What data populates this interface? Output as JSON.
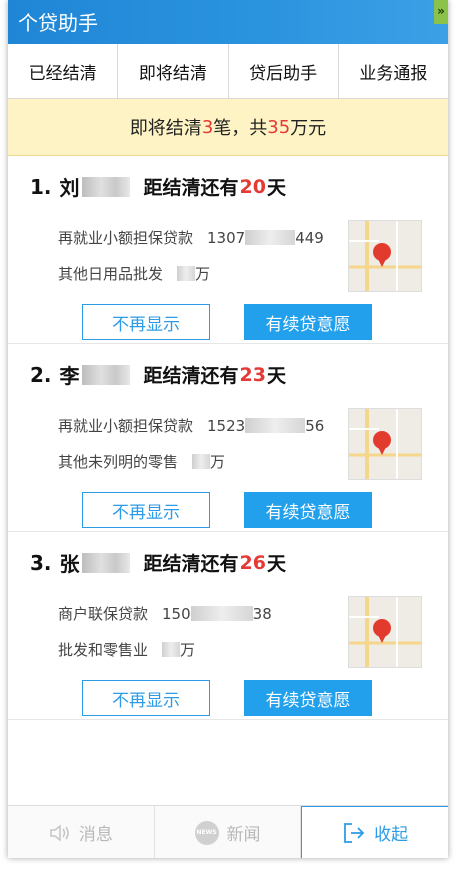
{
  "app": {
    "title": "个贷助手"
  },
  "tabs": [
    {
      "label": "已经结清"
    },
    {
      "label": "即将结清"
    },
    {
      "label": "贷后助手"
    },
    {
      "label": "业务通报"
    }
  ],
  "summary": {
    "prefix": "即将结清",
    "count": "3",
    "mid": "笔，共",
    "amount": "35",
    "suffix": "万元"
  },
  "loans": [
    {
      "index": "1.",
      "surname": "刘",
      "days_prefix": "距结清还有",
      "days": "20",
      "days_suffix": "天",
      "product": "再就业小额担保贷款",
      "phone_start": "1307",
      "phone_end": "449",
      "industry": "其他日用品批发",
      "amount_unit": "万",
      "btn_hide": "不再显示",
      "btn_continue": "有续贷意愿"
    },
    {
      "index": "2.",
      "surname": "李",
      "days_prefix": "距结清还有",
      "days": "23",
      "days_suffix": "天",
      "product": "再就业小额担保贷款",
      "phone_start": "1523",
      "phone_end": "56",
      "industry": "其他未列明的零售",
      "amount_unit": "万",
      "btn_hide": "不再显示",
      "btn_continue": "有续贷意愿"
    },
    {
      "index": "3.",
      "surname": "张",
      "days_prefix": "距结清还有",
      "days": "26",
      "days_suffix": "天",
      "product": "商户联保贷款",
      "phone_start": "150",
      "phone_end": "38",
      "industry": "批发和零售业",
      "amount_unit": "万",
      "btn_hide": "不再显示",
      "btn_continue": "有续贷意愿"
    }
  ],
  "bottom": {
    "messages": "消息",
    "news": "新闻",
    "news_badge": "NEWS",
    "collapse": "收起"
  },
  "colors": {
    "title_bar": "#1f86d6",
    "accent": "#2d9ce6",
    "highlight": "#e53935",
    "summary_bg": "#fdf3c4"
  }
}
